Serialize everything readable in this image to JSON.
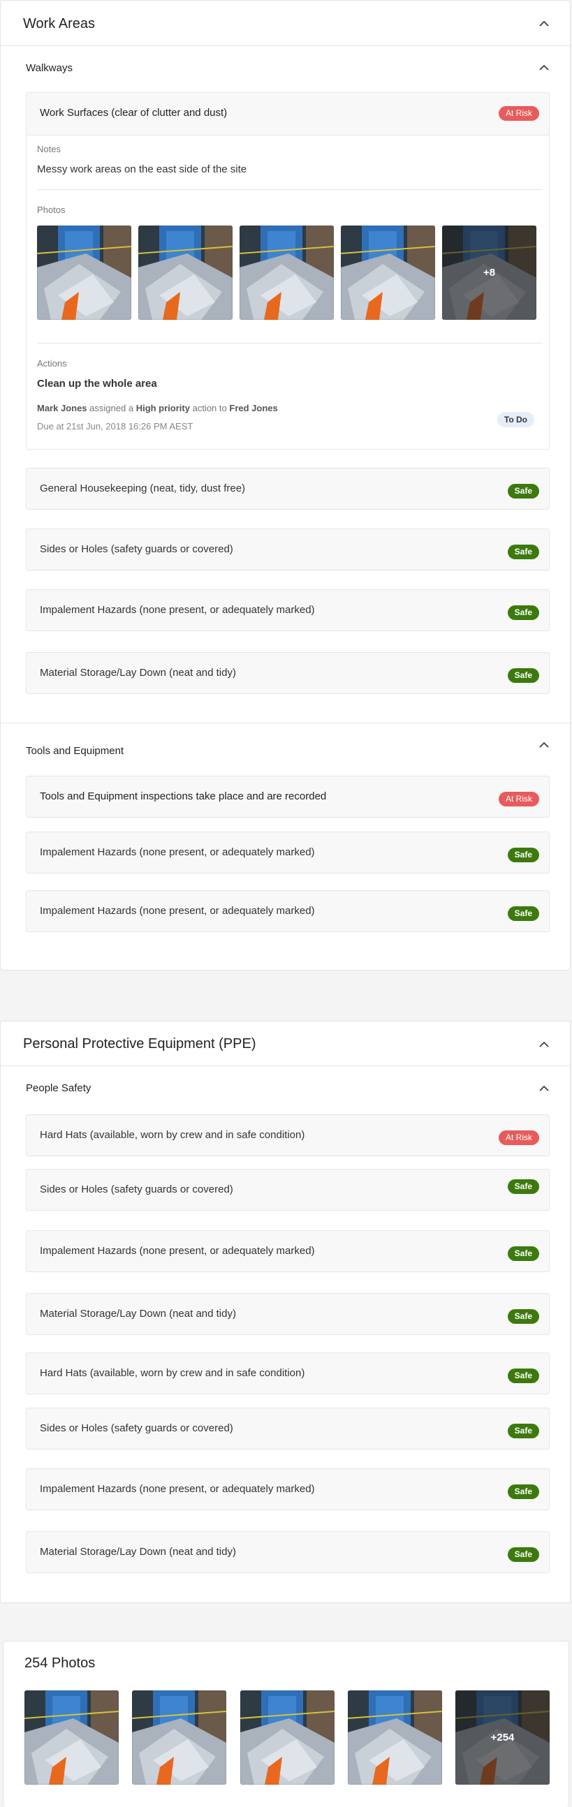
{
  "work_areas": {
    "title": "Work Areas",
    "walkways": {
      "title": "Walkways",
      "expanded_item": {
        "label": "Work Surfaces (clear of clutter and dust)",
        "status": "At Risk",
        "notes_label": "Notes",
        "notes_text": "Messy work areas on the east side of the site",
        "photos_label": "Photos",
        "photos_more": "+8",
        "actions_label": "Actions",
        "action_title": "Clean up the whole area",
        "assigner": "Mark Jones",
        "assigned_a": "assigned a",
        "priority": "High priority",
        "action_to": "action to",
        "assignee": "Fred Jones",
        "due": "Due at 21st Jun, 2018 16:26 PM AEST",
        "action_status": "To Do"
      },
      "items": [
        {
          "label": "General Housekeeping (neat, tidy, dust free)",
          "status": "Safe"
        },
        {
          "label": "Sides or Holes (safety guards or covered)",
          "status": "Safe"
        },
        {
          "label": "Impalement Hazards (none present, or adequately marked)",
          "status": "Safe"
        },
        {
          "label": "Material Storage/Lay Down (neat and tidy)",
          "status": "Safe"
        }
      ]
    },
    "tools": {
      "title": "Tools and Equipment",
      "items": [
        {
          "label": "Tools and Equipment inspections take place and are recorded",
          "status": "At Risk"
        },
        {
          "label": "Impalement Hazards (none present, or adequately marked)",
          "status": "Safe"
        },
        {
          "label": "Impalement Hazards (none present, or adequately marked)",
          "status": "Safe"
        }
      ]
    }
  },
  "ppe": {
    "title": "Personal Protective Equipment (PPE)",
    "people_safety": {
      "title": "People Safety",
      "items": [
        {
          "label": "Hard Hats (available, worn by crew and in safe condition)",
          "status": "At Risk"
        },
        {
          "label": "Sides or Holes (safety guards or covered)",
          "status": "Safe"
        },
        {
          "label": "Impalement Hazards (none present, or adequately marked)",
          "status": "Safe"
        },
        {
          "label": "Material Storage/Lay Down (neat and tidy)",
          "status": "Safe"
        },
        {
          "label": "Hard Hats (available, worn by crew and in safe condition)",
          "status": "Safe"
        },
        {
          "label": "Sides or Holes (safety guards or covered)",
          "status": "Safe"
        },
        {
          "label": "Impalement Hazards (none present, or adequately marked)",
          "status": "Safe"
        },
        {
          "label": "Material Storage/Lay Down (neat and tidy)",
          "status": "Safe"
        }
      ]
    }
  },
  "photos_section": {
    "title": "254 Photos",
    "more": "+254"
  },
  "colors": {
    "safe": "#3c7a0e",
    "at_risk": "#e85b5b",
    "todo_bg": "#e6eef7"
  }
}
